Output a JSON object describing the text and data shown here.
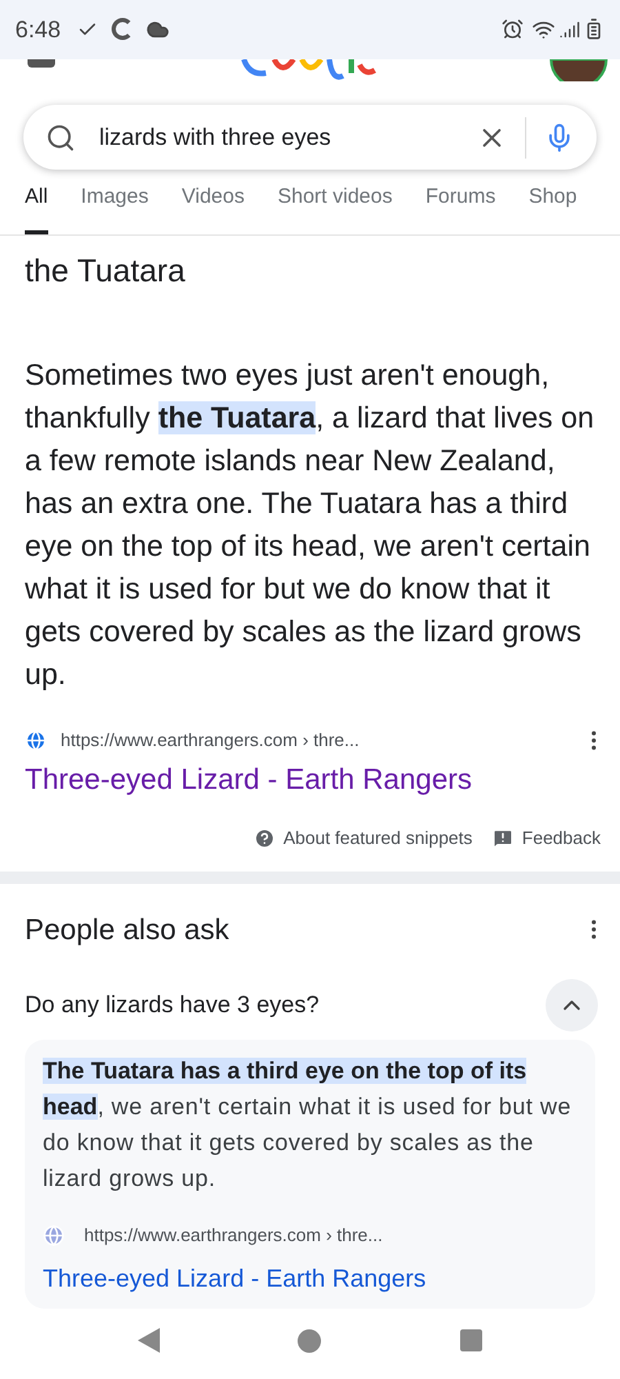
{
  "status_bar": {
    "time": "6:48"
  },
  "search": {
    "value": "lizards with three eyes"
  },
  "tabs": [
    {
      "label": "All",
      "selected": true
    },
    {
      "label": "Images",
      "selected": false
    },
    {
      "label": "Videos",
      "selected": false
    },
    {
      "label": "Short videos",
      "selected": false
    },
    {
      "label": "Forums",
      "selected": false
    },
    {
      "label": "Shop",
      "selected": false
    }
  ],
  "snippet": {
    "heading": "the Tuatara",
    "segments": [
      {
        "text": "Sometimes two eyes just aren't enough, thankfully ",
        "highlighted": false
      },
      {
        "text": "the Tuatara",
        "highlighted": true
      },
      {
        "text": ", a lizard that lives on a few remote islands near New Zealand, has an extra one. The Tuatara has a third eye on the top of its head, we aren't certain what it is used for but we do know that it gets covered by scales as the lizard grows up.",
        "highlighted": false
      }
    ],
    "url": "https://www.earthrangers.com › thre...",
    "link": "Three-eyed Lizard - Earth Rangers",
    "about": "About featured snippets",
    "feedback": "Feedback"
  },
  "people_also_ask": {
    "title": "People also ask",
    "questions": [
      {
        "question": "Do any lizards have 3 eyes?",
        "expanded": true,
        "segments": [
          {
            "text": "The Tuatara has a third eye on the top of its head",
            "highlighted": true
          },
          {
            "text": ", we aren't certain what it is used for but we do know that it gets covered by scales as the lizard grows up.",
            "highlighted": false
          }
        ],
        "url": "https://www.earthrangers.com › thre...",
        "link": "Three-eyed Lizard - Earth Rangers"
      }
    ]
  }
}
